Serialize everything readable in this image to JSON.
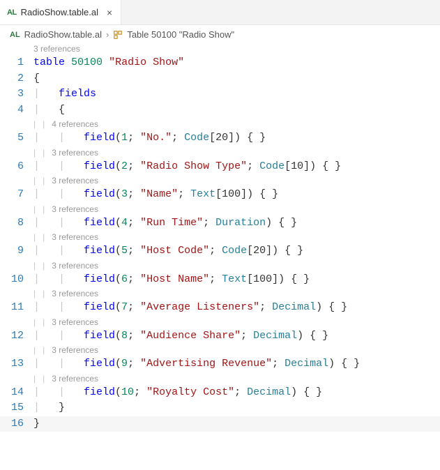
{
  "tab": {
    "badge": "AL",
    "filename": "RadioShow.table.al",
    "close": "×"
  },
  "breadcrumb": {
    "badge": "AL",
    "file": "RadioShow.table.al",
    "sep": "›",
    "symbol": "Table 50100 \"Radio Show\""
  },
  "lens": {
    "table": "3 references",
    "f1": "4 references",
    "f2": "3 references",
    "f3": "3 references",
    "f4": "3 references",
    "f5": "3 references",
    "f6": "3 references",
    "f7": "3 references",
    "f8": "3 references",
    "f9": "3 references",
    "f10": "3 references"
  },
  "code": {
    "table_kw": "table",
    "table_id": "50100",
    "table_name": "\"Radio Show\"",
    "open_brace": "{",
    "fields_kw": "fields",
    "fields_open": "{",
    "field_kw": "field",
    "f1_id": "1",
    "f1_name": "\"No.\"",
    "f1_type": "Code",
    "f1_len": "[20]",
    "f2_id": "2",
    "f2_name": "\"Radio Show Type\"",
    "f2_type": "Code",
    "f2_len": "[10]",
    "f3_id": "3",
    "f3_name": "\"Name\"",
    "f3_type": "Text",
    "f3_len": "[100]",
    "f4_id": "4",
    "f4_name": "\"Run Time\"",
    "f4_type": "Duration",
    "f5_id": "5",
    "f5_name": "\"Host Code\"",
    "f5_type": "Code",
    "f5_len": "[20]",
    "f6_id": "6",
    "f6_name": "\"Host Name\"",
    "f6_type": "Text",
    "f6_len": "[100]",
    "f7_id": "7",
    "f7_name": "\"Average Listeners\"",
    "f7_type": "Decimal",
    "f8_id": "8",
    "f8_name": "\"Audience Share\"",
    "f8_type": "Decimal",
    "f9_id": "9",
    "f9_name": "\"Advertising Revenue\"",
    "f9_type": "Decimal",
    "f10_id": "10",
    "f10_name": "\"Royalty Cost\"",
    "f10_type": "Decimal",
    "fields_close": "}",
    "close_brace": "}",
    "tail": ") { }",
    "semi": "; ",
    "open_paren": "(",
    "guide1": "|   ",
    "guide2": "|   |   "
  },
  "line_numbers": {
    "l1": "1",
    "l2": "2",
    "l3": "3",
    "l4": "4",
    "l5": "5",
    "l6": "6",
    "l7": "7",
    "l8": "8",
    "l9": "9",
    "l10": "10",
    "l11": "11",
    "l12": "12",
    "l13": "13",
    "l14": "14",
    "l15": "15",
    "l16": "16"
  }
}
